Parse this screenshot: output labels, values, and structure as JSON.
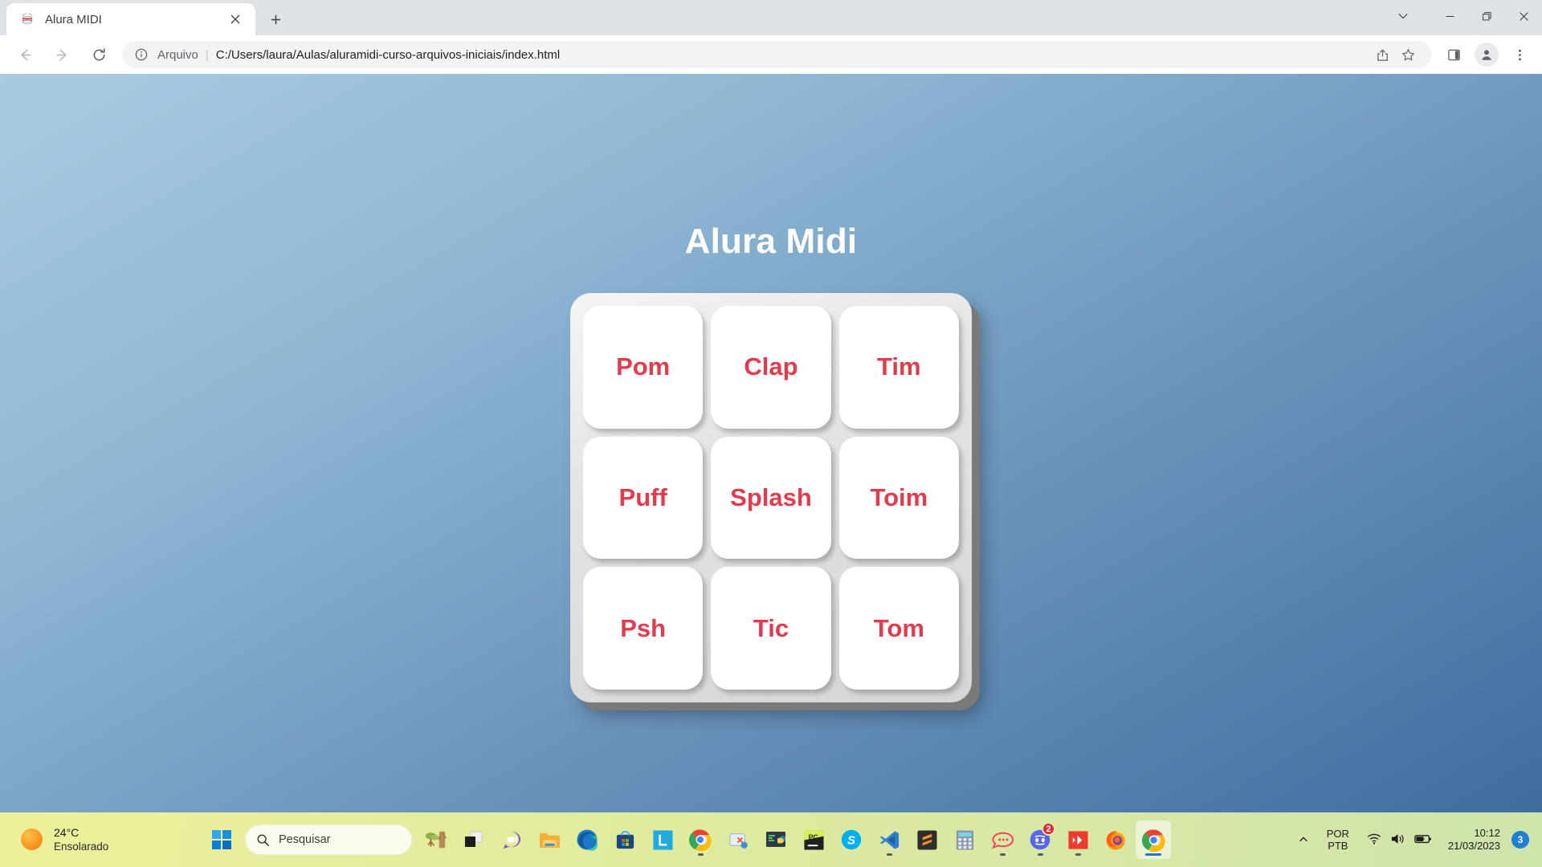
{
  "browser": {
    "tab": {
      "title": "Alura MIDI",
      "favicon": "drum-icon",
      "close_label": "✕"
    },
    "new_tab_label": "+",
    "window_controls": {
      "tab_search": "tab-search-icon",
      "minimize": "minimize-icon",
      "restore": "restore-icon",
      "close": "close-icon"
    },
    "nav": {
      "back": "back-arrow-icon",
      "forward": "forward-arrow-icon",
      "reload": "reload-icon"
    },
    "omnibox": {
      "info_icon": "info-circle-icon",
      "scheme_label": "Arquivo",
      "separator": "|",
      "url": "C:/Users/laura/Aulas/aluramidi-curso-arquivos-iniciais/index.html",
      "share_icon": "share-icon",
      "bookmark_icon": "star-icon"
    },
    "toolbar": {
      "side_panel": "side-panel-icon",
      "profile": "profile-avatar-icon",
      "menu": "three-dot-menu-icon"
    }
  },
  "page": {
    "title": "Alura Midi",
    "accent_color": "#e23b4e",
    "pads": [
      {
        "label": "Pom"
      },
      {
        "label": "Clap"
      },
      {
        "label": "Tim"
      },
      {
        "label": "Puff"
      },
      {
        "label": "Splash"
      },
      {
        "label": "Toim"
      },
      {
        "label": "Psh"
      },
      {
        "label": "Tic"
      },
      {
        "label": "Tom"
      }
    ]
  },
  "taskbar": {
    "weather": {
      "temperature": "24°C",
      "condition": "Ensolarado",
      "icon": "sun-icon"
    },
    "start": {
      "label": "start-button",
      "icon": "windows-logo-icon"
    },
    "search": {
      "placeholder": "Pesquisar",
      "icon": "search-icon"
    },
    "apps": [
      {
        "name": "widgets-tree",
        "icon": "tree-widget-icon",
        "running": false
      },
      {
        "name": "task-view",
        "icon": "task-view-icon",
        "running": false
      },
      {
        "name": "chat",
        "icon": "chat-video-icon",
        "running": false
      },
      {
        "name": "file-explorer",
        "icon": "folder-icon",
        "running": false
      },
      {
        "name": "microsoft-edge",
        "icon": "edge-icon",
        "running": false
      },
      {
        "name": "microsoft-store",
        "icon": "store-icon",
        "running": false
      },
      {
        "name": "l-app",
        "icon": "letter-l-icon",
        "running": false
      },
      {
        "name": "google-chrome-pinned",
        "icon": "chrome-icon",
        "running": true
      },
      {
        "name": "snipping-tool",
        "icon": "snip-icon",
        "running": false
      },
      {
        "name": "python-idle",
        "icon": "python-terminal-icon",
        "running": false
      },
      {
        "name": "pycharm",
        "icon": "pycharm-icon",
        "running": false
      },
      {
        "name": "skype",
        "icon": "skype-icon",
        "running": false
      },
      {
        "name": "visual-studio-code",
        "icon": "vscode-icon",
        "running": true
      },
      {
        "name": "sublime-text",
        "icon": "sublime-icon",
        "running": false
      },
      {
        "name": "calculator",
        "icon": "calculator-icon",
        "running": false
      },
      {
        "name": "rocket-chat",
        "icon": "rocket-chat-icon",
        "running": true
      },
      {
        "name": "discord",
        "icon": "discord-icon",
        "running": true,
        "badge": "2"
      },
      {
        "name": "anydesk",
        "icon": "anydesk-icon",
        "running": true
      },
      {
        "name": "firefox",
        "icon": "firefox-icon",
        "running": false
      },
      {
        "name": "google-chrome",
        "icon": "chrome-icon",
        "running": true,
        "active": true
      }
    ],
    "tray": {
      "chevron": "show-hidden-icons-chevron",
      "language_line1": "POR",
      "language_line2": "PTB",
      "wifi": "wifi-icon",
      "volume": "volume-icon",
      "battery": "battery-charging-icon",
      "time": "10:12",
      "date": "21/03/2023",
      "notification_count": "3"
    }
  }
}
